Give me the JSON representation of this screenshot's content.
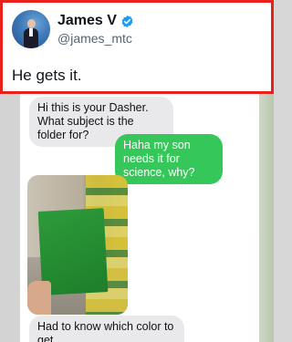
{
  "tweet": {
    "author_name": "James V",
    "handle": "@james_mtc",
    "text": "He gets it.",
    "verified_color": "#1d9bf0",
    "highlight_color": "#e8221b"
  },
  "chat": {
    "incoming_color": "#e9e9eb",
    "outgoing_color": "#35c759",
    "messages": [
      {
        "direction": "incoming",
        "text": "Hi this is your Dasher. What subject is the folder for?"
      },
      {
        "direction": "outgoing",
        "text": "Haha my son needs it for science, why?"
      },
      {
        "direction": "incoming",
        "type": "photo",
        "subject": "green folder"
      },
      {
        "direction": "incoming",
        "text": "Had to know which color to get"
      }
    ]
  }
}
